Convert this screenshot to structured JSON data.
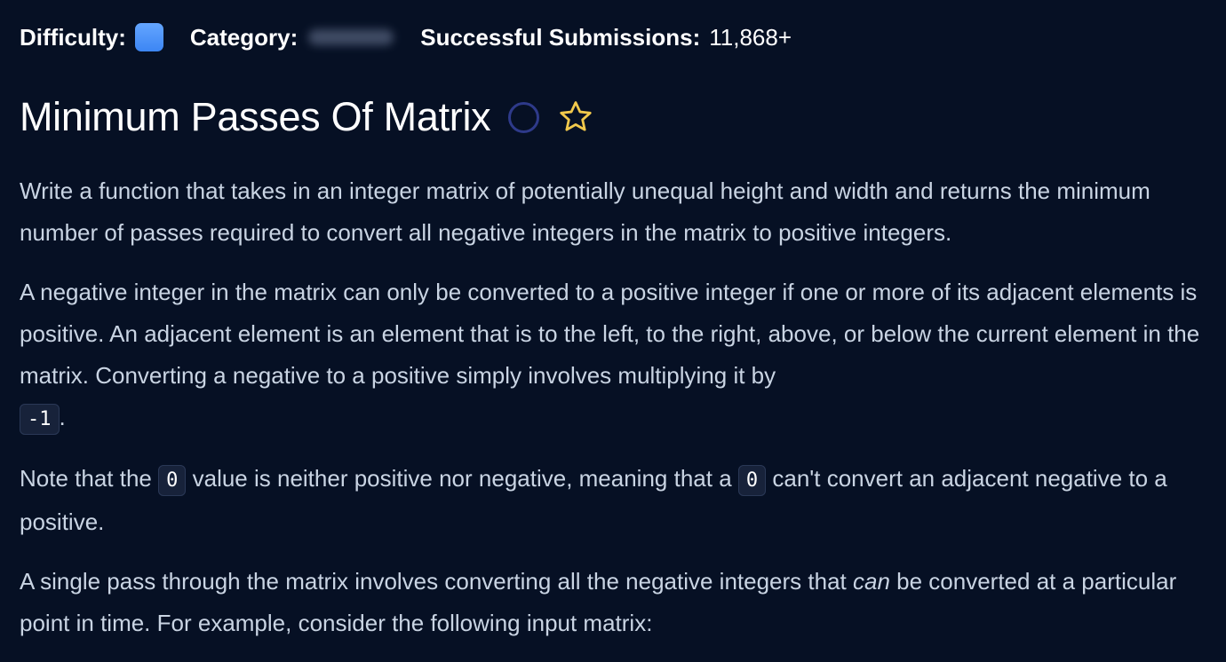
{
  "meta": {
    "difficulty_label": "Difficulty:",
    "category_label": "Category:",
    "submissions_label": "Successful Submissions:",
    "submissions_value": "11,868+",
    "difficulty_color": "#4a90f5"
  },
  "title": {
    "text": "Minimum Passes Of Matrix",
    "completion_icon": "circle-outline-icon",
    "favorite_icon": "star-outline-icon",
    "star_color": "#f2c94c"
  },
  "description": {
    "p1": "Write a function that takes in an integer matrix of potentially unequal height and width and returns the minimum number of passes required to convert all negative integers in the matrix to positive integers.",
    "p2_text": "A negative integer in the matrix can only be converted to a positive integer if one or more of its adjacent elements is positive. An adjacent element is an element that is to the left, to the right, above, or below the current element in the matrix. Converting a negative to a positive simply involves multiplying it by",
    "p2_code": "-1",
    "p2_end": ".",
    "p3_start": "Note that the",
    "p3_code1": "0",
    "p3_middle": "value is neither positive nor negative, meaning that a",
    "p3_code2": "0",
    "p3_end": "can't convert an adjacent negative to a positive.",
    "p4_start": "A single pass through the matrix involves converting all the negative integers that",
    "p4_emphasis": "can",
    "p4_end": "be converted at a particular point in time. For example, consider the following input matrix:"
  }
}
